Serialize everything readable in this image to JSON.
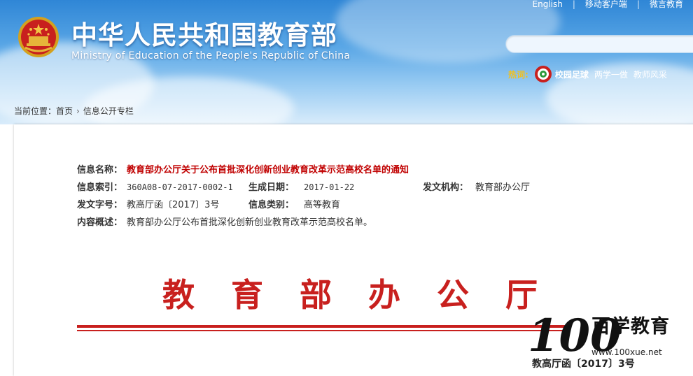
{
  "header": {
    "title": "中华人民共和国教育部",
    "subtitle": "Ministry of Education of the People's Republic of China",
    "top_links": [
      "English",
      "移动客户端",
      "微言教育"
    ],
    "search_placeholder": "",
    "hot": {
      "label": "热词:",
      "items": [
        "校园足球",
        "两学一做",
        "教师风采"
      ]
    }
  },
  "breadcrumb": {
    "prefix": "当前位置：",
    "items": [
      "首页",
      "信息公开专栏"
    ]
  },
  "info": {
    "name_label": "信息名称：",
    "name_value": "教育部办公厅关于公布首批深化创新创业教育改革示范高校名单的通知",
    "index_label": "信息索引：",
    "index_value": "360A08-07-2017-0002-1",
    "date_label": "生成日期：",
    "date_value": "2017-01-22",
    "issuer_label": "发文机构：",
    "issuer_value": "教育部办公厅",
    "docno_label": "发文字号：",
    "docno_value": "教高厅函〔2017〕3号",
    "category_label": "信息类别：",
    "category_value": "高等教育",
    "summary_label": "内容概述：",
    "summary_value": "教育部办公厅公布首批深化创新创业教育改革示范高校名单。"
  },
  "document": {
    "office_title": "教育部办公厅",
    "doc_number": "教高厅函〔2017〕3号"
  },
  "watermark": {
    "number": "100",
    "name": "百学教育",
    "url": "www.100xue.net"
  },
  "colors": {
    "header_blue": "#2f86d6",
    "title_red": "#c8201e",
    "hot_yellow": "#f0c020"
  }
}
